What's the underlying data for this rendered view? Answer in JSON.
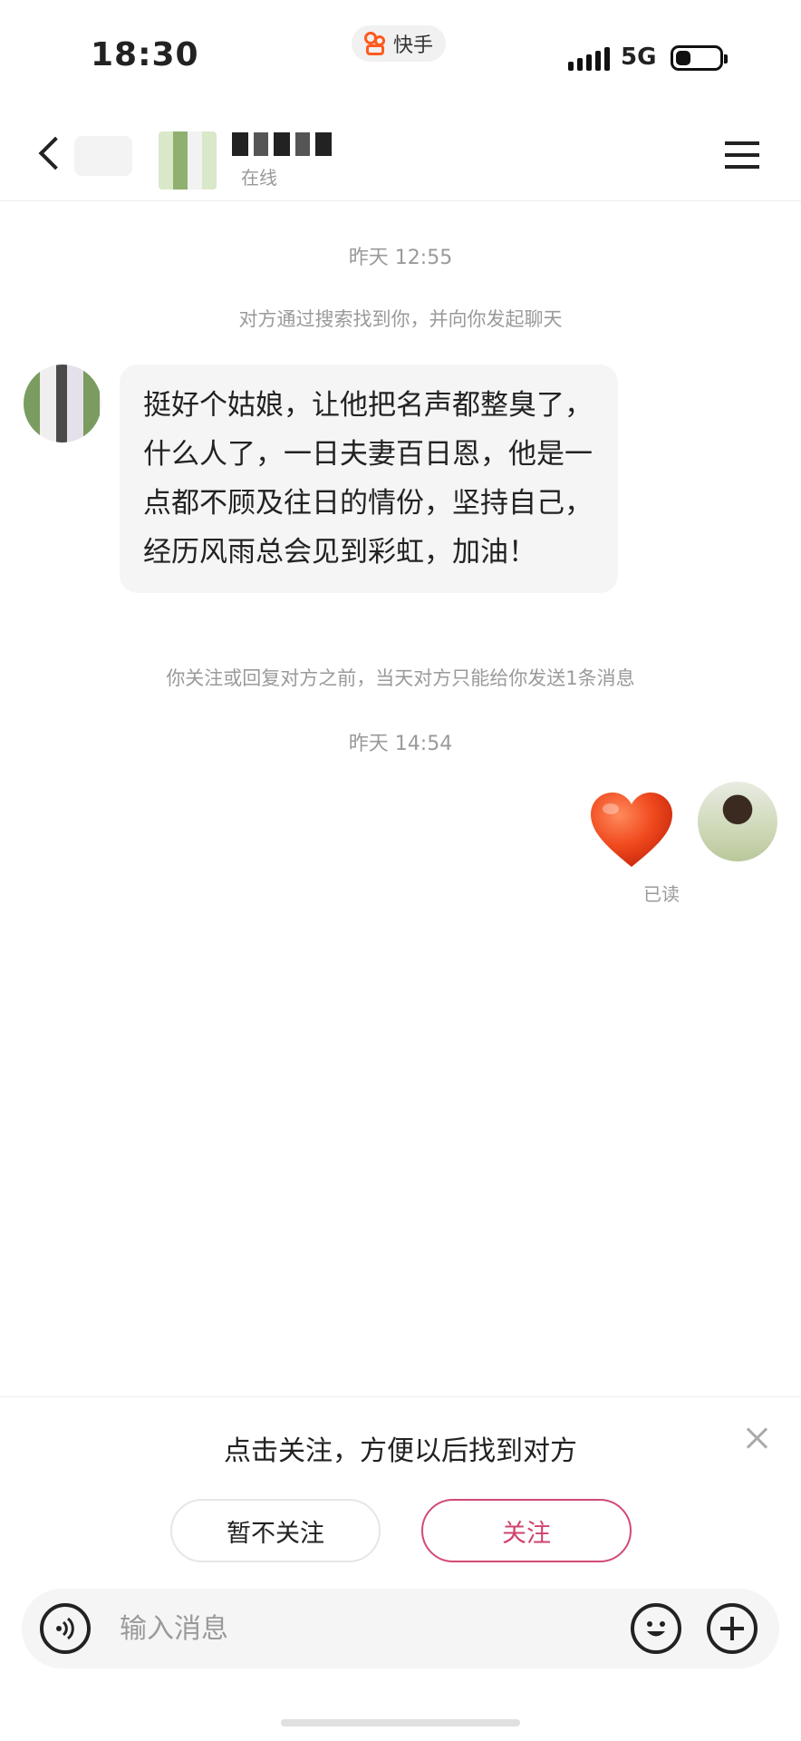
{
  "status_bar": {
    "time": "18:30",
    "app_name": "快手",
    "network": "5G"
  },
  "header": {
    "contact_status": "在线",
    "icons": {
      "back": "chevron-left-icon",
      "menu": "hamburger-menu-icon"
    }
  },
  "conversation": {
    "timestamp_1": "昨天 12:55",
    "system_note_1": "对方通过搜索找到你，并向你发起聊天",
    "incoming_message": "挺好个姑娘，让他把名声都整臭了，什么人了，一日夫妻百日恩，他是一点都不顾及往日的情份，坚持自己，经历风雨总会见到彩虹，加油！",
    "system_note_2": "你关注或回复对方之前，当天对方只能给你发送1条消息",
    "timestamp_2": "昨天 14:54",
    "outgoing_message_icon": "heart-emoji",
    "read_status": "已读"
  },
  "follow_prompt": {
    "text": "点击关注，方便以后找到对方",
    "skip_label": "暂不关注",
    "follow_label": "关注",
    "accent_color": "#d0436c"
  },
  "input_bar": {
    "placeholder": "输入消息",
    "icons": {
      "voice": "voice-icon",
      "emoji": "emoji-icon",
      "more": "plus-icon"
    }
  }
}
